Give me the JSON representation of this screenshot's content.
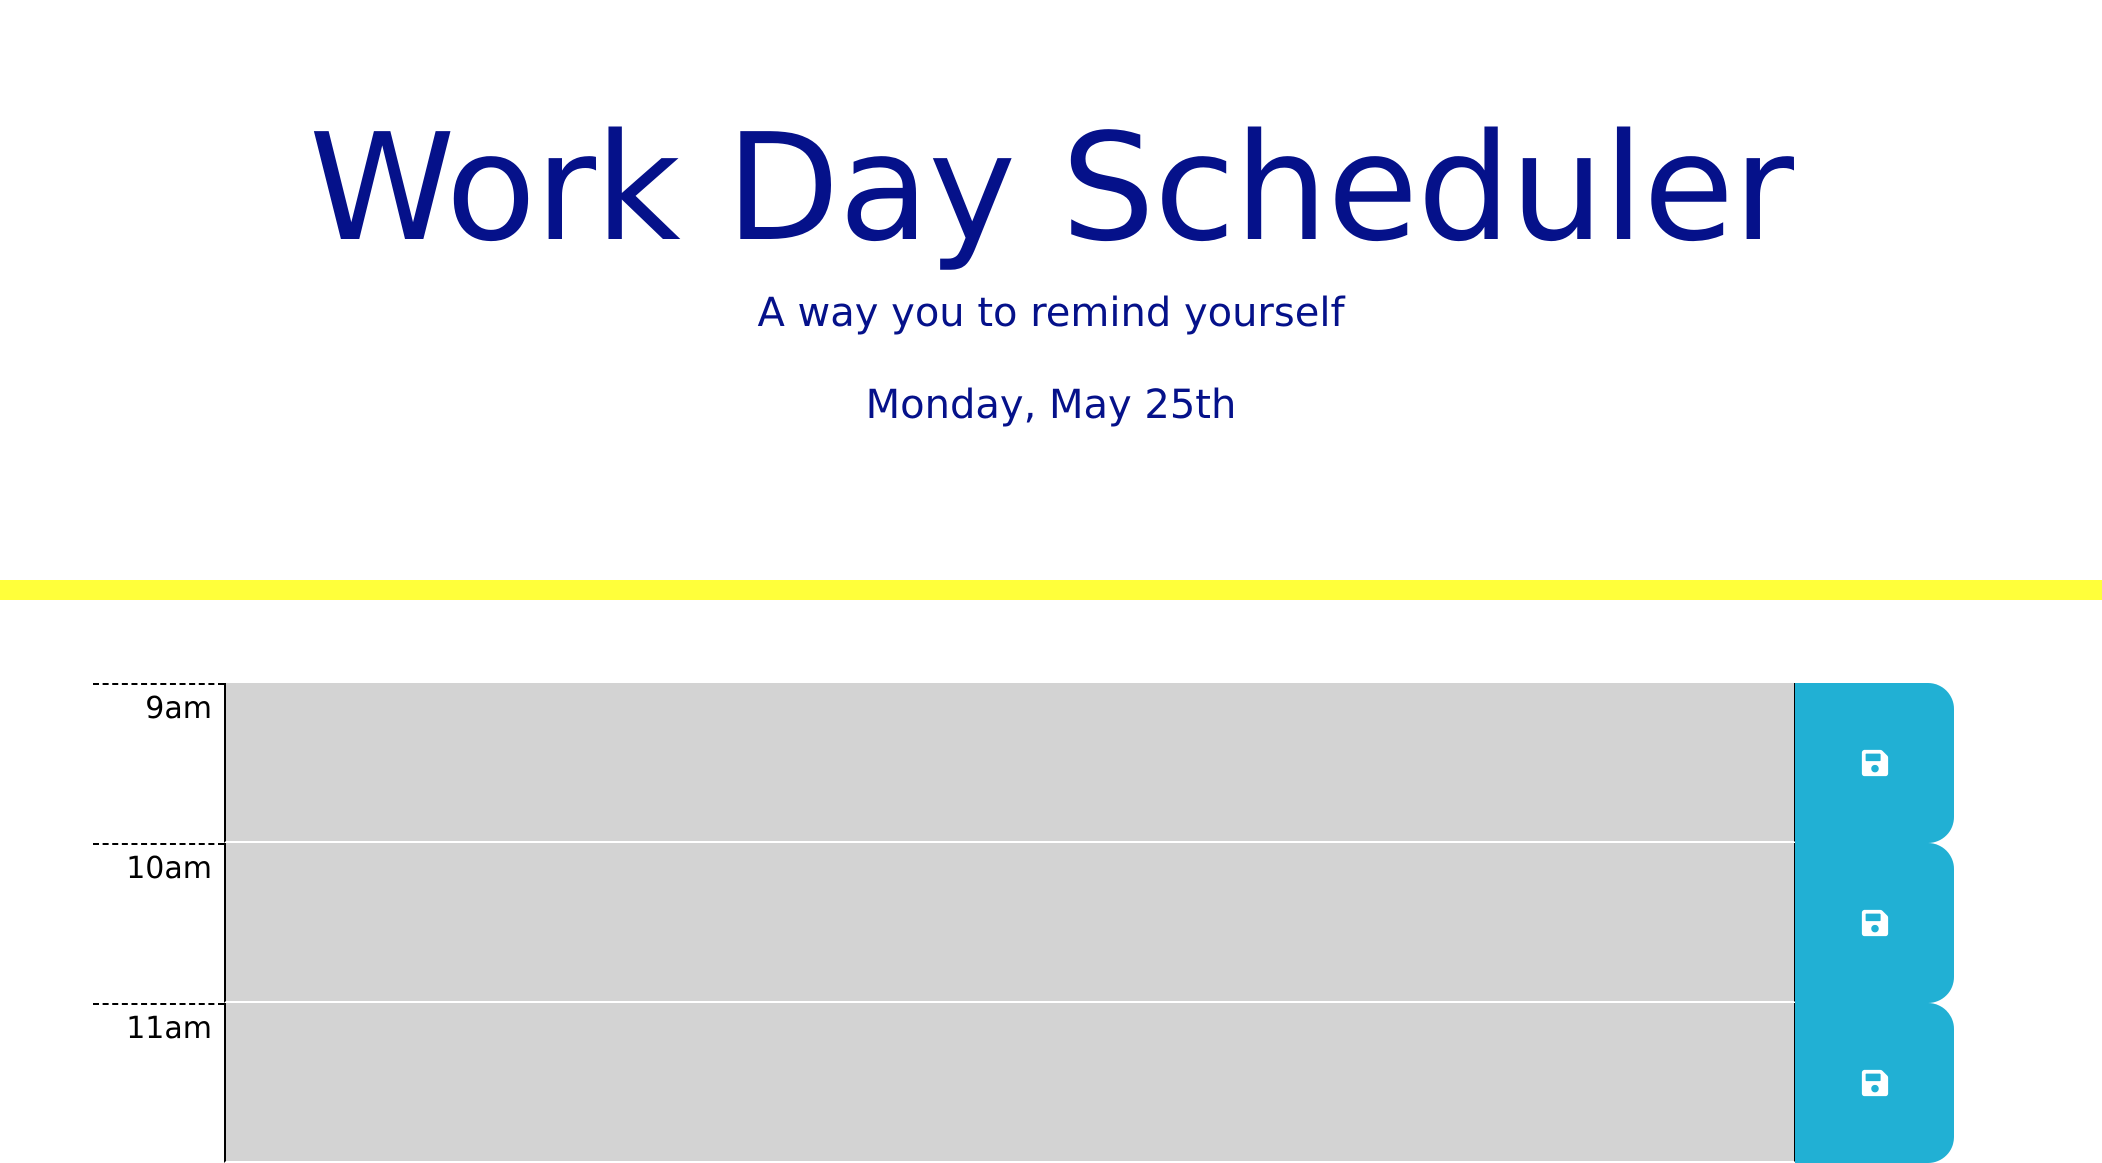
{
  "header": {
    "title": "Work Day Scheduler",
    "subtitle": "A way you to remind yourself",
    "current_day": "Monday, May 25th"
  },
  "colors": {
    "heading": "#05118a",
    "accent_bar": "#ffff3a",
    "past_block": "#d3d3d3",
    "save_button": "#21b0d4",
    "save_icon": "#ffffff"
  },
  "timeblocks": [
    {
      "hour": "9am",
      "text": "",
      "save_icon": "floppy-disk-icon"
    },
    {
      "hour": "10am",
      "text": "",
      "save_icon": "floppy-disk-icon"
    },
    {
      "hour": "11am",
      "text": "",
      "save_icon": "floppy-disk-icon"
    }
  ]
}
